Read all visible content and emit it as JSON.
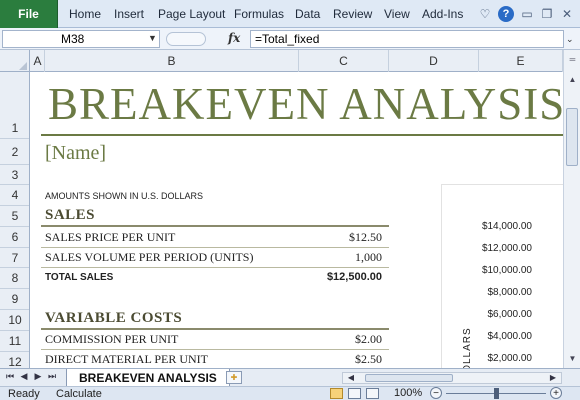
{
  "ribbon": {
    "file_label": "File",
    "tabs": [
      "Home",
      "Insert",
      "Page Layout",
      "Formulas",
      "Data",
      "Review",
      "View",
      "Add-Ins"
    ],
    "icons": [
      "heart-icon",
      "help-icon",
      "minimize-ribbon-icon",
      "restore-icon",
      "close-icon"
    ]
  },
  "formula_bar": {
    "name_box": "M38",
    "fx_label": "fx",
    "formula": "=Total_fixed"
  },
  "columns": [
    "A",
    "B",
    "C",
    "D",
    "E"
  ],
  "rows": [
    "1",
    "2",
    "3",
    "4",
    "5",
    "6",
    "7",
    "8",
    "9",
    "10",
    "11",
    "12"
  ],
  "sheet": {
    "title": "BREAKEVEN ANALYSIS",
    "name_placeholder": "[Name]",
    "currency_note": "AMOUNTS SHOWN IN U.S. DOLLARS",
    "sales_header": "SALES",
    "sales_items": [
      {
        "label": "SALES PRICE PER UNIT",
        "value": "$12.50"
      },
      {
        "label": "SALES VOLUME PER PERIOD (UNITS)",
        "value": "1,000"
      }
    ],
    "total_sales": {
      "label": "TOTAL SALES",
      "value": "$12,500.00"
    },
    "variable_header": "VARIABLE COSTS",
    "variable_items": [
      {
        "label": "COMMISSION PER UNIT",
        "value": "$2.00"
      },
      {
        "label": "DIRECT MATERIAL PER UNIT",
        "value": "$2.50"
      }
    ]
  },
  "chart_data": {
    "type": "line",
    "ylabel": "DOLLARS",
    "y_ticks": [
      "$14,000.00",
      "$12,000.00",
      "$10,000.00",
      "$8,000.00",
      "$6,000.00",
      "$4,000.00",
      "$2,000.00"
    ],
    "ylim": [
      2000,
      14000
    ]
  },
  "tabs_bar": {
    "sheet_tab": "BREAKEVEN ANALYSIS",
    "nav": [
      "first-sheet-icon",
      "prev-sheet-icon",
      "next-sheet-icon",
      "last-sheet-icon"
    ]
  },
  "status_bar": {
    "ready": "Ready",
    "calculate": "Calculate",
    "zoom": "100%",
    "zoom_out": "−",
    "zoom_in": "+"
  }
}
